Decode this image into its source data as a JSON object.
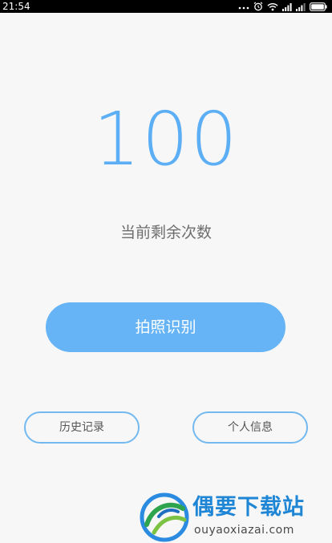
{
  "status_bar": {
    "time": "21:54",
    "icons": [
      "more-dots-icon",
      "alarm-icon",
      "wifi-icon",
      "signal-icon",
      "signal-icon",
      "battery-icon"
    ]
  },
  "main": {
    "count": "100",
    "count_label": "当前剩余次数",
    "primary_button": "拍照识别",
    "history_button": "历史记录",
    "profile_button": "个人信息"
  },
  "watermark": {
    "brand": "偶要下载站",
    "url": "ouyaoxiazai.com"
  },
  "colors": {
    "accent": "#5caef5",
    "button_fill": "#66b4f5",
    "button_outline": "#73b9ef",
    "background": "#f7f7f7"
  }
}
